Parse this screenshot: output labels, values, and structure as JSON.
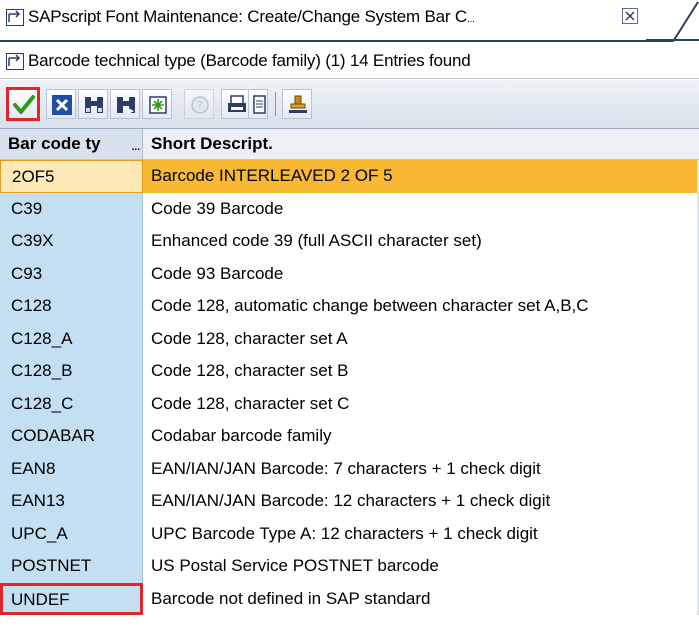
{
  "window": {
    "title": "SAPscript Font Maintenance: Create/Change System Bar C",
    "title_overflow": "..."
  },
  "result_header": {
    "text": "Barcode technical type (Barcode family) (1)   14 Entries found"
  },
  "toolbar": {
    "buttons": [
      {
        "name": "continue",
        "icon": "checkmark-icon",
        "enabled": true,
        "highlighted": true
      },
      {
        "name": "cancel",
        "icon": "cancel-x-icon",
        "enabled": true
      },
      {
        "name": "find",
        "icon": "binoculars-icon",
        "enabled": true
      },
      {
        "name": "find-next",
        "icon": "binoculars-next-icon",
        "enabled": true
      },
      {
        "name": "new",
        "icon": "new-entry-icon",
        "enabled": true
      },
      {
        "name": "information",
        "icon": "help-icon",
        "enabled": false
      },
      {
        "name": "print",
        "icon": "printer-icon",
        "enabled": true
      },
      {
        "name": "print-preview",
        "icon": "page-icon",
        "enabled": true
      },
      {
        "name": "user-settings",
        "icon": "stamp-icon",
        "enabled": true
      }
    ],
    "colors": {
      "checkmark": "#2e9a1a",
      "cancel": "#1f4fa1"
    }
  },
  "table": {
    "columns": [
      "Bar code ty",
      "Short Descript."
    ],
    "column1_truncation": "...",
    "selected_row": 0,
    "marked_row": 13,
    "rows": [
      {
        "key": "2OF5",
        "desc": "Barcode INTERLEAVED 2 OF 5"
      },
      {
        "key": "C39",
        "desc": "Code 39 Barcode"
      },
      {
        "key": "C39X",
        "desc": "Enhanced code 39 (full ASCII character set)"
      },
      {
        "key": "C93",
        "desc": "Code 93 Barcode"
      },
      {
        "key": "C128",
        "desc": "Code 128, automatic change between character set A,B,C"
      },
      {
        "key": "C128_A",
        "desc": "Code 128, character set A"
      },
      {
        "key": "C128_B",
        "desc": "Code 128, character set B"
      },
      {
        "key": "C128_C",
        "desc": "Code 128, character set C"
      },
      {
        "key": "CODABAR",
        "desc": "Codabar barcode family"
      },
      {
        "key": "EAN8",
        "desc": "EAN/IAN/JAN Barcode: 7 characters + 1 check digit"
      },
      {
        "key": "EAN13",
        "desc": "EAN/IAN/JAN Barcode: 12 characters + 1 check digit"
      },
      {
        "key": "UPC_A",
        "desc": "UPC Barcode Type A: 12 characters + 1 check digit"
      },
      {
        "key": "POSTNET",
        "desc": "US Postal Service POSTNET barcode"
      },
      {
        "key": "UNDEF",
        "desc": "Barcode not defined in SAP standard"
      }
    ]
  },
  "colors": {
    "key_column_bg": "#c5dff2",
    "selected_row_bg": "#f8b831",
    "highlight_border": "#e0252b",
    "tab_border": "#2c3e64"
  }
}
